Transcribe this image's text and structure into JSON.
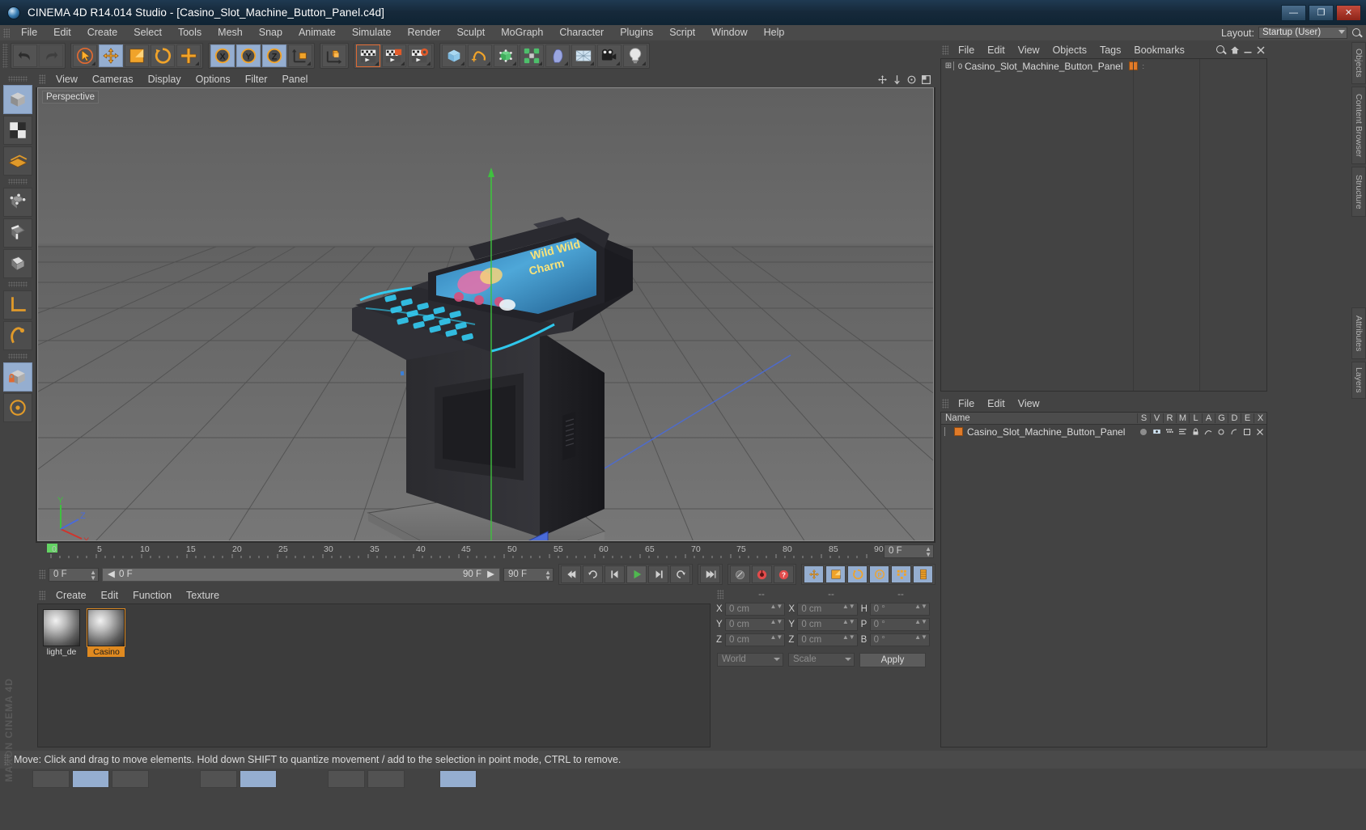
{
  "titlebar": {
    "app_icon": "c4d-logo-icon",
    "title": "CINEMA 4D R14.014 Studio - [Casino_Slot_Machine_Button_Panel.c4d]",
    "minimize": "—",
    "maximize": "❐",
    "close": "✕"
  },
  "menubar": {
    "items": [
      "File",
      "Edit",
      "Create",
      "Select",
      "Tools",
      "Mesh",
      "Snap",
      "Animate",
      "Simulate",
      "Render",
      "Sculpt",
      "MoGraph",
      "Character",
      "Plugins",
      "Script",
      "Window",
      "Help"
    ],
    "layout_label": "Layout:",
    "layout_value": "Startup (User)",
    "search_icon": "magnifier-icon"
  },
  "toolbar": {
    "groups": [
      {
        "name": "history",
        "buttons": [
          {
            "icon": "undo-icon",
            "state": "normal"
          },
          {
            "icon": "redo-icon",
            "state": "disabled"
          }
        ]
      },
      {
        "name": "tools",
        "buttons": [
          {
            "icon": "select-arrow-icon",
            "state": "active"
          },
          {
            "icon": "move-icon",
            "state": "selected"
          },
          {
            "icon": "scale-icon",
            "state": "normal"
          },
          {
            "icon": "rotate-icon",
            "state": "normal"
          },
          {
            "icon": "add-cross-icon",
            "state": "normal"
          }
        ]
      },
      {
        "name": "axis-locks",
        "buttons": [
          {
            "icon": "axis-x-icon",
            "state": "selected"
          },
          {
            "icon": "axis-y-icon",
            "state": "selected"
          },
          {
            "icon": "axis-z-icon",
            "state": "selected"
          },
          {
            "icon": "world-coordinate-icon",
            "state": "normal"
          }
        ]
      },
      {
        "name": "object-axis",
        "buttons": [
          {
            "icon": "object-axis-icon",
            "state": "normal"
          }
        ]
      },
      {
        "name": "render",
        "buttons": [
          {
            "icon": "render-view-icon",
            "state": "active"
          },
          {
            "icon": "render-region-icon",
            "state": "normal"
          },
          {
            "icon": "render-settings-icon",
            "state": "normal"
          }
        ]
      },
      {
        "name": "creation",
        "buttons": [
          {
            "icon": "cube-primitive-icon",
            "state": "normal"
          },
          {
            "icon": "spline-pen-icon",
            "state": "normal"
          },
          {
            "icon": "generator-nurbs-icon",
            "state": "normal"
          },
          {
            "icon": "mograph-cloner-icon",
            "state": "normal"
          },
          {
            "icon": "deformer-bend-icon",
            "state": "normal"
          },
          {
            "icon": "scene-floor-icon",
            "state": "normal"
          },
          {
            "icon": "camera-icon",
            "state": "normal"
          },
          {
            "icon": "light-icon",
            "state": "normal"
          }
        ]
      }
    ]
  },
  "left_palette": {
    "buttons": [
      {
        "icon": "model-mode-icon",
        "state": "selected"
      },
      {
        "icon": "texture-mode-icon",
        "state": "normal"
      },
      {
        "icon": "workplane-mode-icon",
        "state": "normal"
      },
      {
        "icon": "points-mode-icon",
        "state": "normal"
      },
      {
        "icon": "edges-mode-icon",
        "state": "normal"
      },
      {
        "icon": "polygons-mode-icon",
        "state": "normal"
      },
      {
        "icon": "axis-modify-icon",
        "state": "normal"
      },
      {
        "icon": "enable-snap-icon",
        "state": "normal"
      },
      {
        "icon": "lock-axis-icon",
        "state": "selected"
      },
      {
        "icon": "viewport-solo-icon",
        "state": "normal"
      }
    ]
  },
  "viewport": {
    "menu": [
      "View",
      "Cameras",
      "Display",
      "Options",
      "Filter",
      "Panel"
    ],
    "label": "Perspective",
    "right_icons": [
      "pan-view-icon",
      "zoom-view-icon",
      "rotate-view-icon",
      "maximize-view-icon"
    ],
    "axis_gizmo": {
      "y": "Y",
      "z": "Z",
      "x": "X"
    }
  },
  "timeline": {
    "ticks": [
      "0",
      "5",
      "10",
      "15",
      "20",
      "25",
      "30",
      "35",
      "40",
      "45",
      "50",
      "55",
      "60",
      "65",
      "70",
      "75",
      "80",
      "85",
      "90"
    ],
    "current_frame_field": "0 F",
    "start_field": "0 F",
    "scrub_start": "0 F",
    "scrub_end": "90 F",
    "end_field": "90 F",
    "transport": [
      "go-to-start-icon",
      "loop-icon",
      "step-back-icon",
      "play-icon",
      "step-forward-icon",
      "replay-icon",
      "go-to-end-icon"
    ],
    "record_group": [
      "autokey-icon",
      "record-icon",
      "keyframe-selection-icon"
    ],
    "key_group": [
      "position-key-icon",
      "scale-key-icon",
      "rotation-key-icon",
      "parameter-key-icon",
      "pla-key-icon",
      "animation-mode-icon"
    ]
  },
  "material_manager": {
    "menu": [
      "Create",
      "Edit",
      "Function",
      "Texture"
    ],
    "materials": [
      {
        "name": "light_de",
        "selected": false
      },
      {
        "name": "Casino",
        "selected": true
      }
    ]
  },
  "coordinates": {
    "headers": [
      "--",
      "--",
      "--"
    ],
    "rows": [
      {
        "label1": "X",
        "value1": "0 cm",
        "label2": "X",
        "value2": "0 cm",
        "label3": "H",
        "value3": "0 °"
      },
      {
        "label1": "Y",
        "value1": "0 cm",
        "label2": "Y",
        "value2": "0 cm",
        "label3": "P",
        "value3": "0 °"
      },
      {
        "label1": "Z",
        "value1": "0 cm",
        "label2": "Z",
        "value2": "0 cm",
        "label3": "B",
        "value3": "0 °"
      }
    ],
    "system_select": "World",
    "mode_select": "Scale",
    "apply_label": "Apply"
  },
  "object_manager": {
    "menu": [
      "File",
      "Edit",
      "View",
      "Objects",
      "Tags",
      "Bookmarks"
    ],
    "right_icons": [
      "search-icon",
      "home-icon",
      "minimize-icon",
      "close-icon"
    ],
    "objects": [
      {
        "name": "Casino_Slot_Machine_Button_Panel",
        "expander": "⊞",
        "level_badge": "0",
        "tag_color": "#e07a28"
      }
    ]
  },
  "layer_manager": {
    "menu": [
      "File",
      "Edit",
      "View"
    ],
    "columns": [
      "Name",
      "S",
      "V",
      "R",
      "M",
      "L",
      "A",
      "G",
      "D",
      "E",
      "X"
    ],
    "rows": [
      {
        "name": "Casino_Slot_Machine_Button_Panel",
        "color": "#e07a28"
      }
    ]
  },
  "right_dock_tabs": [
    "Objects",
    "Content Browser",
    "Structure",
    "Attributes",
    "Layers"
  ],
  "statusbar": {
    "message": "Move: Click and drag to move elements. Hold down SHIFT to quantize movement / add to the selection in point mode, CTRL to remove."
  },
  "colors": {
    "accent_orange": "#e58a2e",
    "selected_blue": "#95aed0",
    "panel_bg": "#434343",
    "titlebar_blue": "#16293a",
    "neon_cyan": "#2fd0f5",
    "axis_red": "#d0342c",
    "axis_green": "#3fc03f",
    "axis_blue": "#4a6bd8"
  },
  "watermark": "MAXON CINEMA 4D"
}
